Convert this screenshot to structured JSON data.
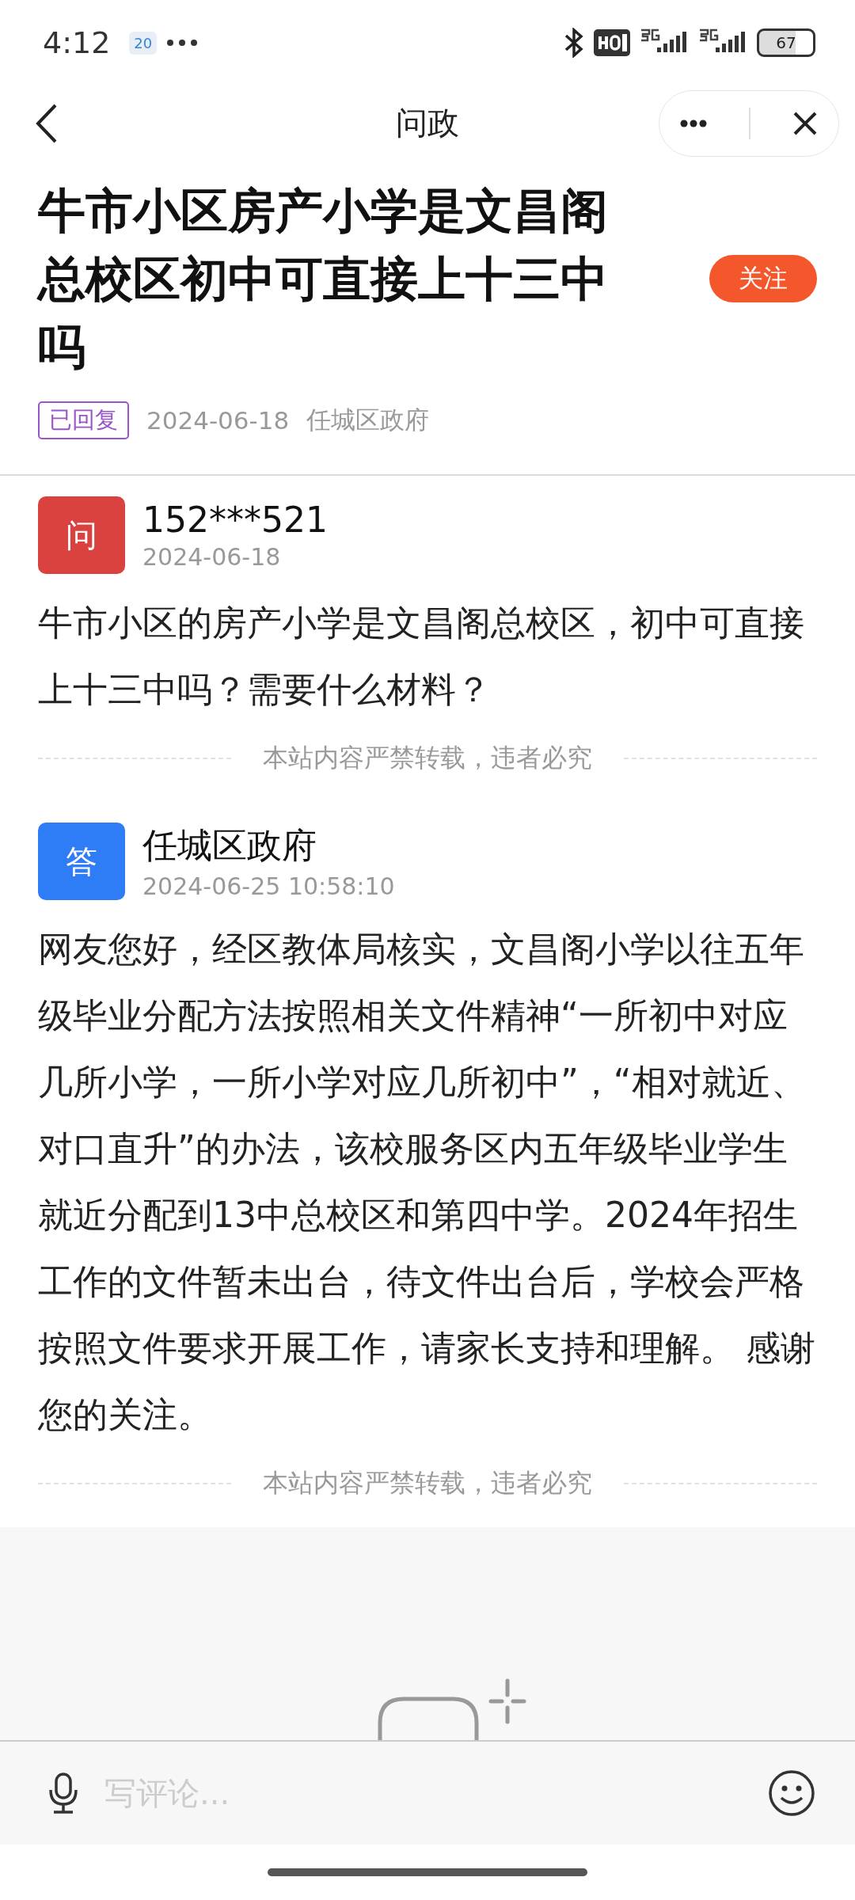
{
  "status_bar": {
    "time": "4:12",
    "calendar_day": "20",
    "battery": "67"
  },
  "nav": {
    "title": "问政"
  },
  "post": {
    "title": "牛市小区房产小学是文昌阁总校区初中可直接上十三中吗",
    "follow_label": "关注",
    "status_tag": "已回复",
    "date": "2024-06-18",
    "department": "任城区政府"
  },
  "messages": [
    {
      "kind": "question",
      "avatar": "问",
      "name": "152***521",
      "time": "2024-06-18",
      "text": "牛市小区的房产小学是文昌阁总校区，初中可直接上十三中吗？需要什么材料？",
      "notice": "本站内容严禁转载，违者必究"
    },
    {
      "kind": "answer",
      "avatar": "答",
      "name": "任城区政府",
      "time": "2024-06-25 10:58:10",
      "text": "网友您好，经区教体局核实，文昌阁小学以往五年级毕业分配方法按照相关文件精神“一所初中对应几所小学，一所小学对应几所初中”，“相对就近、对口直升”的办法，该校服务区内五年级毕业学生就近分配到13中总校区和第四中学。2024年招生工作的文件暂未出台，待文件出台后，学校会严格按照文件要求开展工作，请家长支持和理解。 感谢您的关注。",
      "notice": "本站内容严禁转载，违者必究"
    }
  ],
  "comment_bar": {
    "placeholder": "写评论..."
  }
}
